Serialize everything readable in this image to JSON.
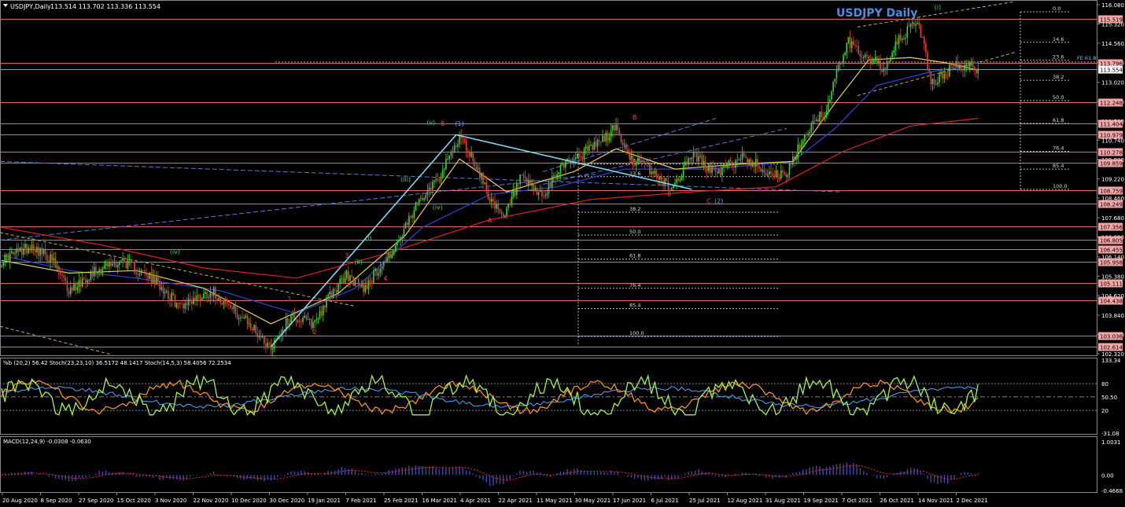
{
  "header": {
    "symbol_line": "USDJPY,Daily",
    "ohlc": "113.514 113.702 113.336 113.554",
    "title": "USDJPY Daily"
  },
  "colors": {
    "background": "#000000",
    "price_label": "#f4a6a6",
    "current_price_label": "#ffffff",
    "hline": "#e06a6a",
    "ma_slow": "#e02020",
    "ma_mid": "#2b45d8",
    "ma_fast": "#e8d050",
    "bull": "#3cd23c",
    "bear": "#e64040",
    "impulse": "#7fd8f0",
    "stoch_main": "#a6f050",
    "stoch_signal": "#ff9a20",
    "blue_line": "#4aa8ff",
    "macd_hist": "#3d4aaa",
    "macd_signal": "#e03030",
    "wave_green": "#3cd23c",
    "wave_red": "#ff4040",
    "wave_blue": "#58a8ff",
    "grid": "#555555",
    "text": "#ffffff"
  },
  "chart_data": {
    "type": "candlestick",
    "title": "USDJPY Daily",
    "ylim": [
      102.32,
      116.08
    ],
    "price_axis_ticks": [
      "116.080",
      "115.320",
      "114.560",
      "113.800",
      "113.020",
      "112.260",
      "111.500",
      "110.740",
      "109.980",
      "109.220",
      "108.460",
      "107.680",
      "106.920",
      "106.140",
      "105.380",
      "104.620",
      "103.840",
      "103.080",
      "102.320"
    ],
    "price_levels": [
      "115.519",
      "113.796",
      "112.248",
      "111.404",
      "110.979",
      "110.278",
      "109.859",
      "108.759",
      "108.249",
      "107.356",
      "106.805",
      "106.455",
      "105.958",
      "105.111",
      "104.438",
      "103.036",
      "102.614"
    ],
    "current_price": "113.554",
    "date_labels": [
      "20 Aug 2020",
      "8 Sep 2020",
      "27 Sep 2020",
      "15 Oct 2020",
      "3 Nov 2020",
      "22 Nov 2020",
      "10 Dec 2020",
      "30 Dec 2020",
      "19 Jan 2021",
      "7 Feb 2021",
      "25 Feb 2021",
      "16 Mar 2021",
      "4 Apr 2021",
      "22 Apr 2021",
      "11 May 2021",
      "30 May 2021",
      "17 Jun 2021",
      "6 Jul 2021",
      "25 Jul 2021",
      "12 Aug 2021",
      "31 Aug 2021",
      "19 Sep 2021",
      "7 Oct 2021",
      "26 Oct 2021",
      "14 Nov 2021",
      "2 Dec 2021"
    ],
    "anchors": [
      [
        0,
        106.0
      ],
      [
        18,
        106.6
      ],
      [
        30,
        106.0
      ],
      [
        40,
        104.8
      ],
      [
        55,
        105.6
      ],
      [
        72,
        106.0
      ],
      [
        95,
        105.0
      ],
      [
        105,
        104.2
      ],
      [
        125,
        104.8
      ],
      [
        145,
        103.6
      ],
      [
        160,
        102.6
      ],
      [
        172,
        103.8
      ],
      [
        185,
        103.5
      ],
      [
        195,
        104.6
      ],
      [
        205,
        105.4
      ],
      [
        215,
        104.9
      ],
      [
        235,
        106.6
      ],
      [
        250,
        108.6
      ],
      [
        262,
        109.5
      ],
      [
        272,
        110.9
      ],
      [
        280,
        110.0
      ],
      [
        292,
        108.2
      ],
      [
        298,
        107.6
      ],
      [
        308,
        109.2
      ],
      [
        322,
        108.5
      ],
      [
        333,
        109.8
      ],
      [
        345,
        110.2
      ],
      [
        360,
        110.9
      ],
      [
        365,
        111.3
      ],
      [
        372,
        110.1
      ],
      [
        385,
        109.6
      ],
      [
        398,
        108.8
      ],
      [
        410,
        110.2
      ],
      [
        425,
        109.4
      ],
      [
        440,
        110.1
      ],
      [
        455,
        109.5
      ],
      [
        466,
        109.3
      ],
      [
        474,
        110.5
      ],
      [
        482,
        111.5
      ],
      [
        490,
        111.9
      ],
      [
        497,
        113.6
      ],
      [
        503,
        114.6
      ],
      [
        510,
        114.2
      ],
      [
        518,
        113.9
      ],
      [
        525,
        113.5
      ],
      [
        532,
        114.6
      ],
      [
        539,
        115.1
      ],
      [
        544,
        115.5
      ],
      [
        548,
        114.4
      ],
      [
        552,
        112.9
      ],
      [
        558,
        113.3
      ],
      [
        565,
        113.6
      ],
      [
        573,
        113.7
      ],
      [
        580,
        113.55
      ]
    ],
    "moving_averages": [
      {
        "name": "slow",
        "points": [
          [
            0,
            107.3
          ],
          [
            60,
            106.6
          ],
          [
            120,
            105.7
          ],
          [
            175,
            105.3
          ],
          [
            230,
            106.3
          ],
          [
            290,
            107.6
          ],
          [
            350,
            108.4
          ],
          [
            410,
            108.7
          ],
          [
            460,
            108.9
          ],
          [
            500,
            110.3
          ],
          [
            540,
            111.3
          ],
          [
            580,
            111.6
          ]
        ]
      },
      {
        "name": "mid",
        "points": [
          [
            0,
            106.2
          ],
          [
            40,
            105.6
          ],
          [
            80,
            105.3
          ],
          [
            130,
            104.8
          ],
          [
            175,
            103.9
          ],
          [
            210,
            104.9
          ],
          [
            250,
            107.3
          ],
          [
            290,
            108.6
          ],
          [
            330,
            108.9
          ],
          [
            370,
            109.6
          ],
          [
            420,
            109.6
          ],
          [
            470,
            109.9
          ],
          [
            495,
            111.2
          ],
          [
            520,
            112.9
          ],
          [
            550,
            113.4
          ],
          [
            580,
            113.8
          ]
        ]
      },
      {
        "name": "fast",
        "points": [
          [
            0,
            106.0
          ],
          [
            40,
            105.5
          ],
          [
            80,
            105.6
          ],
          [
            120,
            104.9
          ],
          [
            160,
            103.5
          ],
          [
            200,
            104.7
          ],
          [
            240,
            107.0
          ],
          [
            272,
            110.0
          ],
          [
            300,
            108.7
          ],
          [
            340,
            109.5
          ],
          [
            365,
            110.4
          ],
          [
            400,
            109.6
          ],
          [
            440,
            109.8
          ],
          [
            470,
            109.9
          ],
          [
            495,
            112.2
          ],
          [
            515,
            113.9
          ],
          [
            540,
            114.0
          ],
          [
            560,
            113.8
          ],
          [
            580,
            113.5
          ]
        ]
      }
    ],
    "impulse_wave": [
      [
        160,
        102.6
      ],
      [
        270,
        110.95
      ],
      [
        410,
        108.8
      ]
    ],
    "wave_labels": [
      {
        "text": "1",
        "i": 171,
        "p": 104.4,
        "c": "red"
      },
      {
        "text": "2",
        "i": 186,
        "p": 103.1,
        "c": "red"
      },
      {
        "text": "3",
        "i": 205,
        "p": 106.1,
        "c": "red"
      },
      {
        "text": "4",
        "i": 228,
        "p": 105.2,
        "c": "red"
      },
      {
        "text": "5",
        "i": 262,
        "p": 111.3,
        "c": "red"
      },
      {
        "text": "A",
        "i": 290,
        "p": 107.5,
        "c": "red"
      },
      {
        "text": "B",
        "i": 376,
        "p": 111.55,
        "c": "red"
      },
      {
        "text": "C",
        "i": 420,
        "p": 108.25,
        "c": "red"
      },
      {
        "text": "(1)",
        "i": 272,
        "p": 111.3,
        "c": "blue"
      },
      {
        "text": "(2)",
        "i": 426,
        "p": 108.25,
        "c": "blue"
      },
      {
        "text": "(i)",
        "i": 218,
        "p": 106.8,
        "c": "green"
      },
      {
        "text": "(ii)",
        "i": 212,
        "p": 105.85,
        "c": "green"
      },
      {
        "text": "(iii)",
        "i": 240,
        "p": 109.1,
        "c": "green"
      },
      {
        "text": "(iv)",
        "i": 259,
        "p": 108.0,
        "c": "green"
      },
      {
        "text": "(v)",
        "i": 255,
        "p": 111.35,
        "c": "green"
      },
      {
        "text": "(iv)",
        "i": 103,
        "p": 106.25,
        "c": "green"
      },
      {
        "text": "(i)",
        "i": 556,
        "p": 115.9,
        "c": "green"
      }
    ],
    "fib_right": [
      "0.0",
      "14.6",
      "23.6",
      "38.2",
      "50.0",
      "61.8",
      "76.4",
      "85.4",
      "100.0"
    ],
    "fib_right_levels": [
      115.8,
      114.6,
      113.9,
      113.1,
      112.3,
      111.4,
      110.3,
      109.6,
      108.8
    ],
    "fib_mid": [
      "14.6",
      "23.6",
      "38.2",
      "50.0",
      "61.8",
      "76.4",
      "85.4",
      "100.0"
    ],
    "fib_mid_levels": [
      109.8,
      109.3,
      107.9,
      107.0,
      106.05,
      104.9,
      104.1,
      103.0
    ],
    "fe_label": "FE 61.8",
    "stoch_header": "%b (20,2) 56.42  Stoch(23,23,10) 36.5172 48.1417  Stoch(14,5,3) 58.4056 72.2534",
    "stoch_axis": [
      "133.34",
      "80",
      "50.50",
      "20",
      "-31.08"
    ],
    "macd_header": "MACD(12,24,9) -0.0308 -0.0630",
    "macd_axis": [
      "1.0031",
      "0.00",
      "-0.4668"
    ]
  }
}
